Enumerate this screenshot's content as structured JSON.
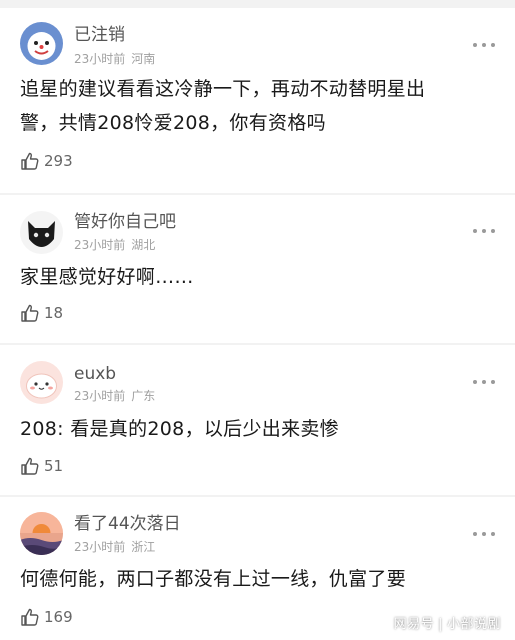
{
  "comments": [
    {
      "username": "已注销",
      "time": "23小时前",
      "location": "河南",
      "text_line1": "追星的建议看看这冷静一下，再动不动替明星出",
      "text_line2": "警，共情208怜爱208，你有资格吗",
      "likes": "293",
      "avatar_icon": "blue-cartoon-avatar-icon"
    },
    {
      "username": "管好你自己吧",
      "time": "23小时前",
      "location": "湖北",
      "text_line1": "家里感觉好好啊……",
      "likes": "18",
      "avatar_icon": "black-cat-avatar-icon"
    },
    {
      "username": "euxb",
      "time": "23小时前",
      "location": "广东",
      "text_line1": "208: 看是真的208，以后少出来卖惨",
      "likes": "51",
      "avatar_icon": "pink-blob-avatar-icon"
    },
    {
      "username": "看了44次落日",
      "time": "23小时前",
      "location": "浙江",
      "text_line1": "何德何能，两口子都没有上过一线，仇富了要",
      "likes": "169",
      "avatar_icon": "sunset-avatar-icon"
    }
  ],
  "watermark": {
    "brand": "网易号",
    "separator": "|",
    "author": "小部说剧"
  },
  "colors": {
    "background": "#f2f2f2",
    "card": "#ffffff",
    "meta_text": "#a0a0a0"
  }
}
